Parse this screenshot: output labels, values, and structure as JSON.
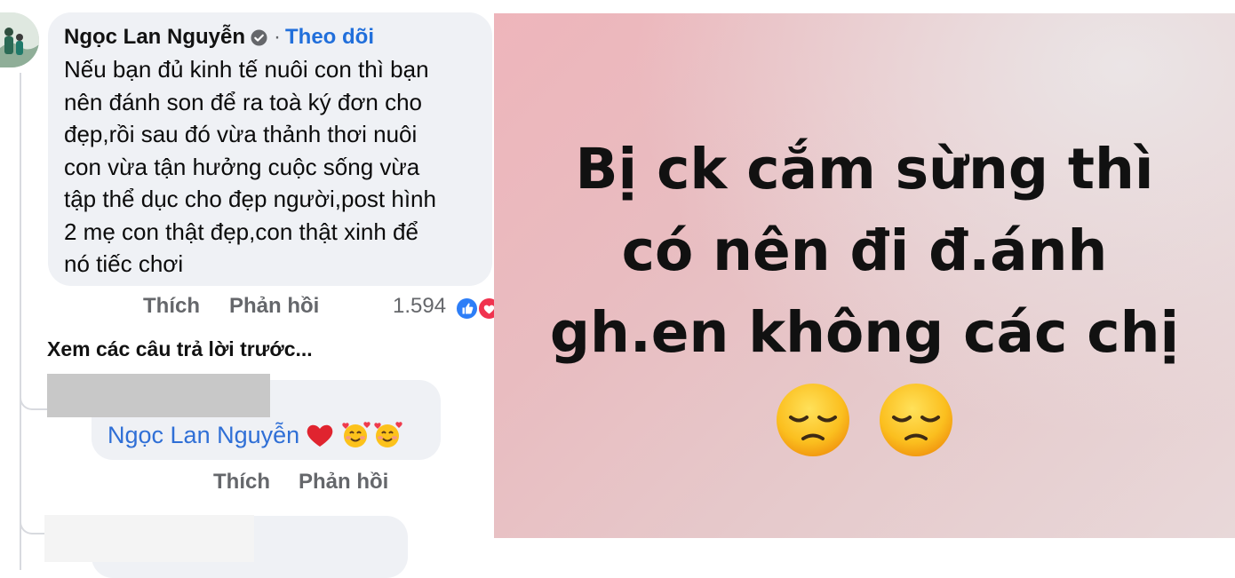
{
  "comment": {
    "author": "Ngọc Lan Nguyễn",
    "separator": "·",
    "follow_label": "Theo dõi",
    "body_lines": [
      "Nếu bạn đủ kinh tế nuôi con thì bạn",
      "nên đánh son để ra toà ký đơn cho",
      "đẹp,rồi sau đó vừa thảnh thơi nuôi",
      "con vừa tận hưởng cuộc sống vừa",
      "tập thể dục cho đẹp người,post hình",
      "2 mẹ con thật đẹp,con thật xinh để",
      "nó tiếc chơi"
    ],
    "like_label": "Thích",
    "reply_label": "Phản hồi",
    "reaction_count": "1.594"
  },
  "replies": {
    "see_previous": "Xem các câu trả lời trước...",
    "reply1": {
      "mention": "Ngọc Lan Nguyễn",
      "emojis": [
        "heart",
        "smiling-face-with-hearts",
        "smiling-face-with-hearts"
      ],
      "like_label": "Thích",
      "reply_label": "Phản hồi"
    }
  },
  "post_image": {
    "lines": [
      "Bị ck cắm sừng thì",
      "có nên đi đ.ánh",
      "gh.en không các chị"
    ],
    "emojis": [
      "pensive-face",
      "pensive-face"
    ]
  },
  "colors": {
    "link_blue": "#216fdb",
    "mention_blue": "#2f6fd6",
    "bubble_bg": "#eff1f5",
    "muted_text": "#65676b"
  }
}
